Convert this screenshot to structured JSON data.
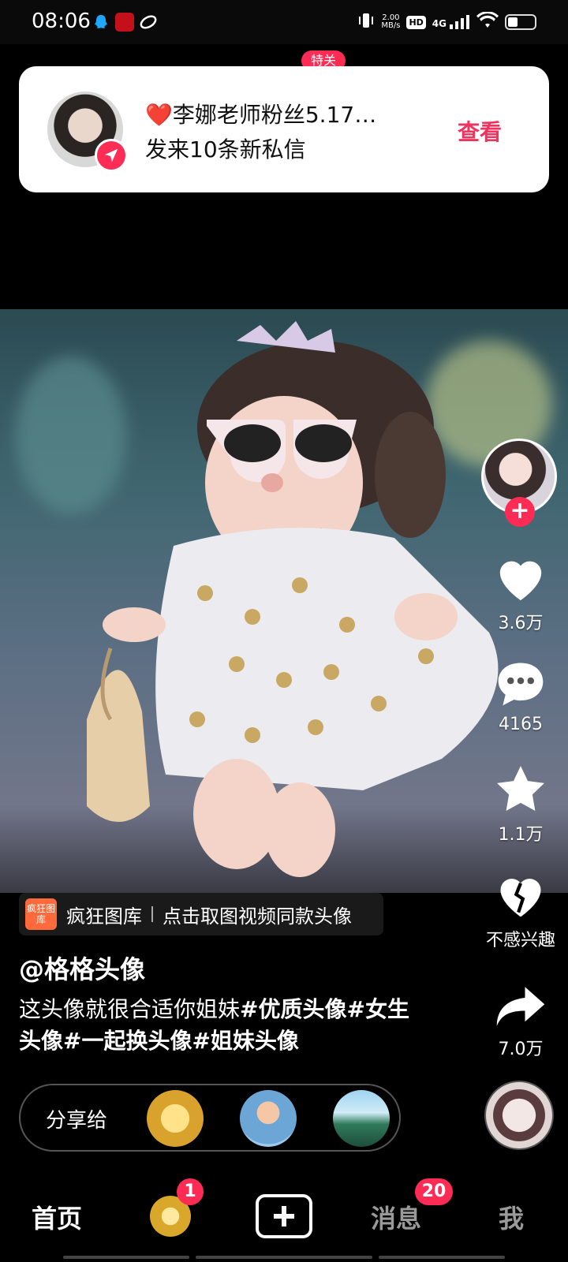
{
  "status_bar": {
    "time": "08:06",
    "net_speed_value": "2.00",
    "net_speed_unit": "MB/s",
    "hd": "HD",
    "signal": "4G",
    "battery_percent": 35
  },
  "notification": {
    "tag_peek": "特关",
    "title": "❤️李娜老师粉丝5.17…",
    "message": "发来10条新私信",
    "action_label": "查看"
  },
  "video": {
    "source_logo_text": "疯狂图库",
    "source_name": "疯狂图库",
    "source_hint": "点击取图视频同款头像",
    "username": "@格格头像",
    "caption_text": "这头像就很合适你姐妹",
    "caption_tags": "#优质头像#女生头像#一起换头像#姐妹头像"
  },
  "actions": {
    "like_count": "3.6万",
    "comment_count": "4165",
    "favorite_count": "1.1万",
    "not_interested": "不感兴趣",
    "share_count": "7.0万"
  },
  "share_bar": {
    "label": "分享给"
  },
  "bottom_nav": {
    "home": "首页",
    "coin_badge": "1",
    "messages": "消息",
    "messages_badge": "20",
    "me": "我"
  },
  "colors": {
    "accent": "#fe2c55",
    "view_link": "#f0325e"
  }
}
